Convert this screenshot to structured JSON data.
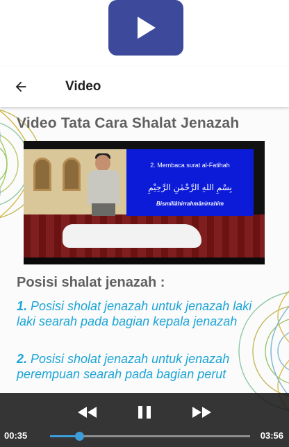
{
  "app_logo": {
    "icon": "play-icon",
    "color": "#3d4a9b"
  },
  "appbar": {
    "title": "Video",
    "back_icon": "arrow-left-icon"
  },
  "content": {
    "heading": "Video Tata Cara Shalat Jenazah",
    "video_thumbnail": {
      "panel_title": "2. Membaca surat al-Fatihah",
      "panel_arabic": "بِسْمِ اللهِ الرَّحْمٰنِ الرَّحِيْمِ",
      "panel_latin": "Bismillâhirrahmânirrahîm"
    },
    "subheading": "Posisi shalat jenazah :",
    "items": [
      {
        "number": "1.",
        "text": " Posisi sholat jenazah untuk jenazah laki laki searah pada bagian kepala jenazah"
      },
      {
        "number": "2.",
        "text": " Posisi sholat jenazah untuk jenazah perempuan searah pada bagian perut"
      }
    ]
  },
  "media_controller": {
    "rewind_icon": "rewind-icon",
    "pause_icon": "pause-icon",
    "fast_forward_icon": "fast-forward-icon",
    "current_time": "00:35",
    "total_time": "03:56",
    "progress": 0.148
  },
  "colors": {
    "accent_text": "#1ba4d6",
    "heading_text": "#606060",
    "seek_bar": "#3d9ddb",
    "logo_bg": "#3d4a9b"
  }
}
